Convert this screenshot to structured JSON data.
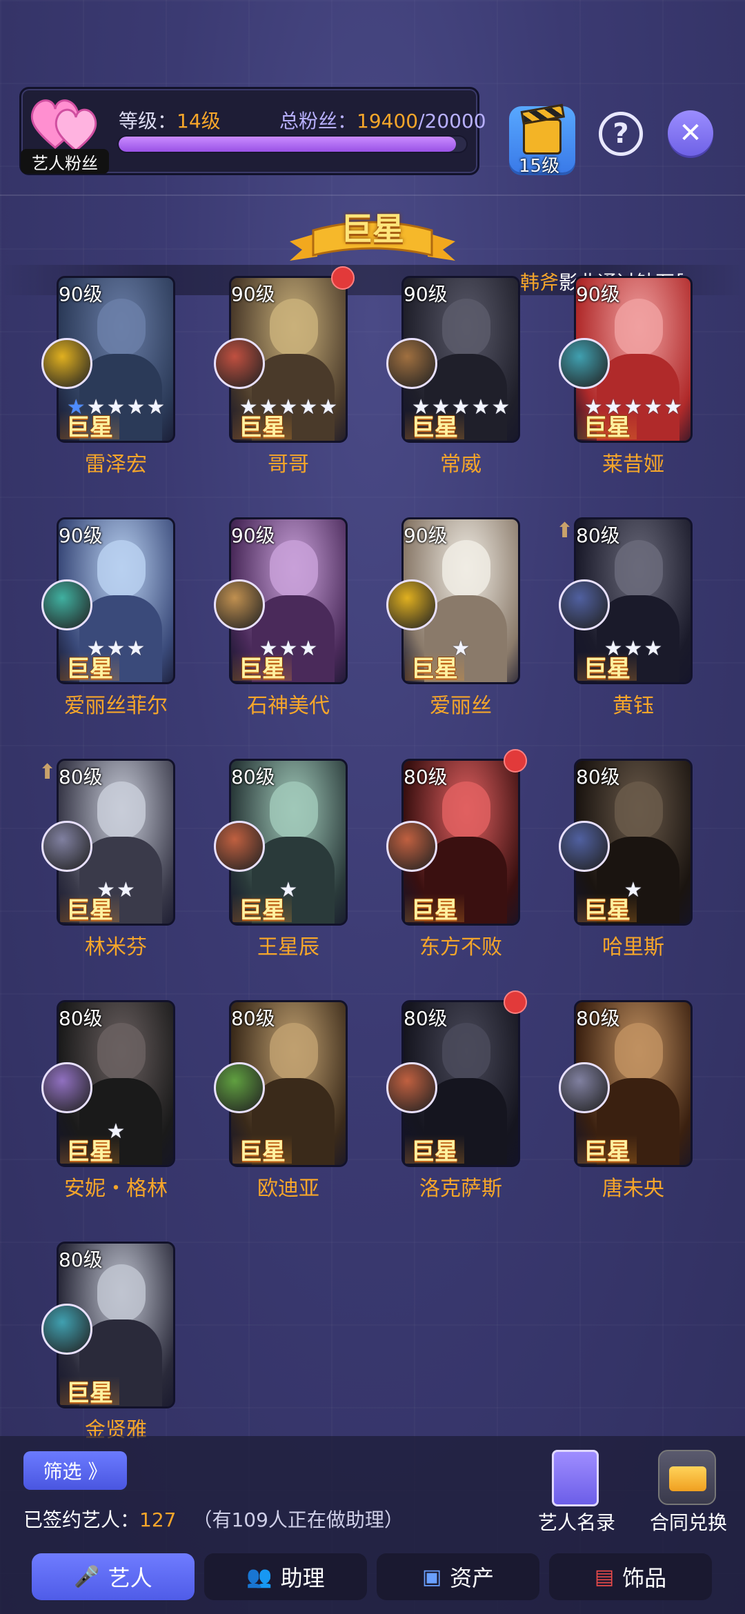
{
  "header": {
    "fan_label": "艺人粉丝",
    "level_prefix": "等级：",
    "level_value": "14级",
    "fans_prefix": "总粉丝：",
    "fans_current": "19400",
    "fans_max": "/20000",
    "fans_progress": 0.97,
    "film_level": "15级"
  },
  "banner": {
    "title": "巨星",
    "marquee_name": "韩斧",
    "marquee_msg": "影业通过钻石星"
  },
  "artists": [
    {
      "level": "90级",
      "rank": "巨星",
      "name": "雷泽宏",
      "stars": "★★★★★",
      "blue_stars": 1
    },
    {
      "level": "90级",
      "rank": "巨星",
      "name": "哥哥",
      "stars": "★★★★★",
      "blue_stars": 0
    },
    {
      "level": "90级",
      "rank": "巨星",
      "name": "常威",
      "stars": "★★★★★",
      "blue_stars": 0
    },
    {
      "level": "90级",
      "rank": "巨星",
      "name": "莱昔娅",
      "stars": "★★★★★",
      "blue_stars": 0
    },
    {
      "level": "90级",
      "rank": "巨星",
      "name": "爱丽丝菲尔",
      "stars": "★★★"
    },
    {
      "level": "90级",
      "rank": "巨星",
      "name": "石神美代",
      "stars": "★★★"
    },
    {
      "level": "90级",
      "rank": "巨星",
      "name": "爱丽丝",
      "stars": "★"
    },
    {
      "level": "80级",
      "rank": "巨星",
      "name": "黄钰",
      "stars": "★★★"
    },
    {
      "level": "80级",
      "rank": "巨星",
      "name": "林米芬",
      "stars": "★★"
    },
    {
      "level": "80级",
      "rank": "巨星",
      "name": "王星辰",
      "stars": "★"
    },
    {
      "level": "80级",
      "rank": "巨星",
      "name": "东方不败",
      "stars": ""
    },
    {
      "level": "80级",
      "rank": "巨星",
      "name": "哈里斯",
      "stars": "★"
    },
    {
      "level": "80级",
      "rank": "巨星",
      "name": "安妮・格林",
      "stars": "★"
    },
    {
      "level": "80级",
      "rank": "巨星",
      "name": "欧迪亚",
      "stars": ""
    },
    {
      "level": "80级",
      "rank": "巨星",
      "name": "洛克萨斯",
      "stars": ""
    },
    {
      "level": "80级",
      "rank": "巨星",
      "name": "唐未央",
      "stars": ""
    },
    {
      "level": "80级",
      "rank": "巨星",
      "name": "金贤雅",
      "stars": ""
    }
  ],
  "footer": {
    "filter_label": "筛选 》",
    "signed_prefix": "已签约艺人：",
    "signed_count": "127",
    "assistant_note": "（有109人正在做助理）",
    "roster_label": "艺人名录",
    "contract_label": "合同兑换"
  },
  "tabs": [
    {
      "label": "艺人",
      "icon": "microphone-icon"
    },
    {
      "label": "助理",
      "icon": "assistant-icon"
    },
    {
      "label": "资产",
      "icon": "assets-icon"
    },
    {
      "label": "饰品",
      "icon": "accessory-icon"
    }
  ],
  "colors": {
    "accent_orange": "#f6a62a",
    "progress_purple": "#b06cf5",
    "tab_active_blue": "#5f6cf2",
    "background": "#3b3a72"
  }
}
